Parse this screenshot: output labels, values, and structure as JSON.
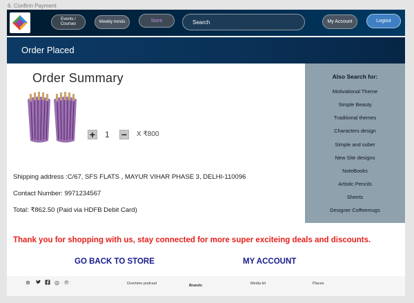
{
  "frame_label": "6. Confirm Payment",
  "nav": {
    "events_line1": "Events /",
    "events_line2": "Courses",
    "weekly": "Weekly trends",
    "store": "Store",
    "search_placeholder": "Search",
    "account": "My Account",
    "logout": "Logout"
  },
  "banner": {
    "title": "Order Placed"
  },
  "summary": {
    "title": "Order Summary",
    "plus": "+",
    "minus": "−",
    "quantity": "1",
    "price": "X ₹800"
  },
  "details": {
    "shipping": "Shipping address :C/67, SFS FLATS , MAYUR VIHAR PHASE 3, DELHI-110096",
    "contact": "Contact Number: 9971234567",
    "total": "Total: ₹862.50 (Paid via HDFB Debit Card)"
  },
  "sidebar": {
    "title": "Also Search for:",
    "items": [
      "Motivational Theme",
      "Simple Beauty",
      "Traditional themes",
      "Characters design",
      "Simple and sober",
      "New Site designs",
      "NoteBooks",
      "Artisitc Pencils",
      "Sheets",
      "Designer Coffeemugs"
    ]
  },
  "thanks": "Thank you for shopping with us, stay connected for more super exciteing deals and discounts.",
  "cta": {
    "store": "GO BACK TO STORE",
    "account": "MY ACCOUNT"
  },
  "footer": {
    "social_icons": [
      "dribbble-icon",
      "twitter-icon",
      "facebook-icon",
      "instagram-icon",
      "pinterest-icon"
    ],
    "social_glyphs": [
      "⊛",
      "🐦",
      "f",
      "◎",
      "℗"
    ],
    "links": [
      "Overtime podcast",
      "Brands",
      "Media kit",
      "Places"
    ]
  },
  "colors": {
    "nav_bg": "#002849",
    "banner_bg": "#0a3157",
    "sidebar_bg": "#8fa1ad",
    "thanks_red": "#e3201b",
    "cta_blue": "#161a8c",
    "account_btn": "#3f7fc4"
  }
}
